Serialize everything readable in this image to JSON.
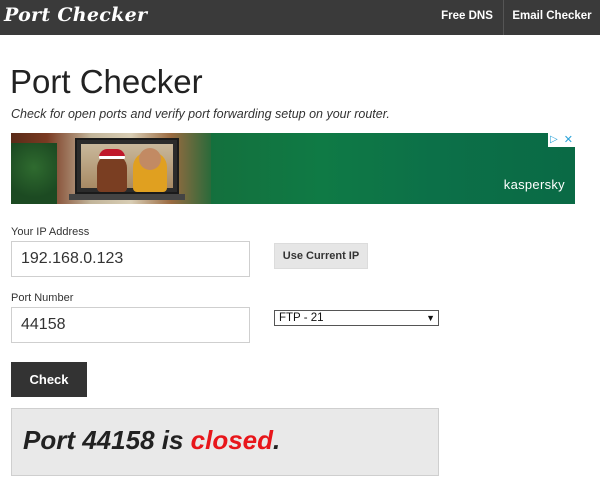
{
  "header": {
    "logo": "Port Checker",
    "nav": {
      "free_dns": "Free DNS",
      "email_checker": "Email Checker"
    }
  },
  "main": {
    "title": "Port Checker",
    "subtitle": "Check for open ports and verify port forwarding setup on your router."
  },
  "ad": {
    "brand": "kaspersky",
    "choices_icon": "adchoices-icon",
    "close_icon": "close-icon"
  },
  "form": {
    "ip_label": "Your IP Address",
    "ip_value": "192.168.0.123",
    "use_current_ip": "Use Current IP",
    "port_label": "Port Number",
    "port_value": "44158",
    "service_selected": "FTP - 21",
    "check_button": "Check"
  },
  "result": {
    "prefix": "Port 44158 is ",
    "status": "closed",
    "suffix": "."
  },
  "colors": {
    "topbar": "#3a3a3a",
    "check_button": "#333333",
    "closed_status": "#e8161b",
    "result_box": "#e9e9e9",
    "ad_green": "#0f7a45"
  }
}
